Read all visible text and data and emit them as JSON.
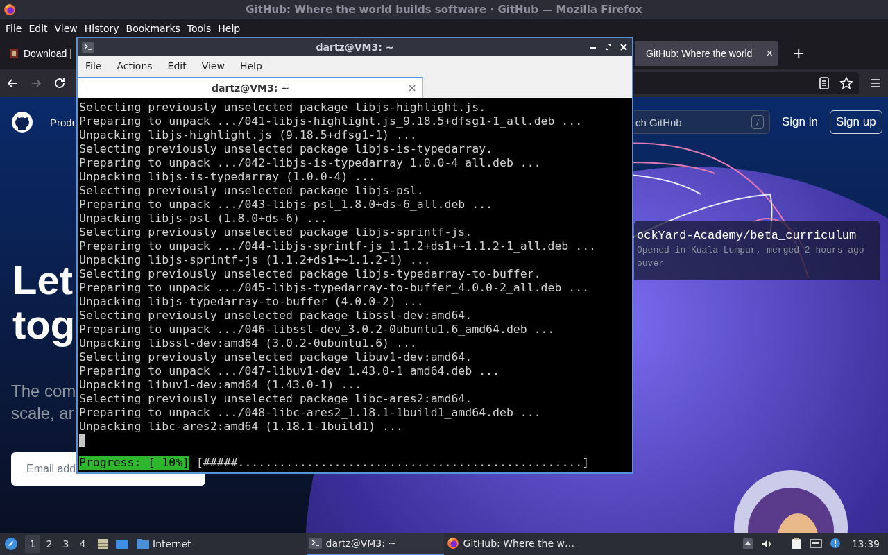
{
  "firefox": {
    "title": "GitHub: Where the world builds software · GitHub — Mozilla Firefox",
    "menu": [
      "File",
      "Edit",
      "View",
      "History",
      "Bookmarks",
      "Tools",
      "Help"
    ],
    "tabs": [
      {
        "label": "Download |",
        "selected": false
      },
      {
        "label": "GitHub: Where the world",
        "selected": true,
        "close": "×"
      }
    ],
    "new_tab": "+",
    "nav_buttons": [
      {
        "kind": "back",
        "disabled": false
      },
      {
        "kind": "forward",
        "disabled": true
      },
      {
        "kind": "reload",
        "disabled": false
      }
    ]
  },
  "page": {
    "nav_item": "Produ",
    "search_placeholder": "ch GitHub",
    "search_key": "/",
    "sign_in": "Sign in",
    "sign_up": "Sign up",
    "headline": [
      "Let",
      "tog"
    ],
    "subtitle": [
      "The com",
      "scale, ar"
    ],
    "email_placeholder": "Email add",
    "card": {
      "title": "ockYard-Academy/beta_curriculum",
      "lines": [
        "Opened in Kuala Lumpur, merged 2 hours ago",
        "ouver"
      ]
    }
  },
  "terminal": {
    "title": "dartz@VM3: ~",
    "menu": [
      "File",
      "Actions",
      "Edit",
      "View",
      "Help"
    ],
    "tabs": [
      {
        "label": "dartz@VM3: ~",
        "selected": true,
        "close": "×"
      }
    ],
    "lines": [
      "Selecting previously unselected package libjs-highlight.js.",
      "Preparing to unpack .../041-libjs-highlight.js_9.18.5+dfsg1-1_all.deb ...",
      "Unpacking libjs-highlight.js (9.18.5+dfsg1-1) ...",
      "Selecting previously unselected package libjs-is-typedarray.",
      "Preparing to unpack .../042-libjs-is-typedarray_1.0.0-4_all.deb ...",
      "Unpacking libjs-is-typedarray (1.0.0-4) ...",
      "Selecting previously unselected package libjs-psl.",
      "Preparing to unpack .../043-libjs-psl_1.8.0+ds-6_all.deb ...",
      "Unpacking libjs-psl (1.8.0+ds-6) ...",
      "Selecting previously unselected package libjs-sprintf-js.",
      "Preparing to unpack .../044-libjs-sprintf-js_1.1.2+ds1+~1.1.2-1_all.deb ...",
      "Unpacking libjs-sprintf-js (1.1.2+ds1+~1.1.2-1) ...",
      "Selecting previously unselected package libjs-typedarray-to-buffer.",
      "Preparing to unpack .../045-libjs-typedarray-to-buffer_4.0.0-2_all.deb ...",
      "Unpacking libjs-typedarray-to-buffer (4.0.0-2) ...",
      "Selecting previously unselected package libssl-dev:amd64.",
      "Preparing to unpack .../046-libssl-dev_3.0.2-0ubuntu1.6_amd64.deb ...",
      "Unpacking libssl-dev:amd64 (3.0.2-0ubuntu1.6) ...",
      "Selecting previously unselected package libuv1-dev:amd64.",
      "Preparing to unpack .../047-libuv1-dev_1.43.0-1_amd64.deb ...",
      "Unpacking libuv1-dev:amd64 (1.43.0-1) ...",
      "Selecting previously unselected package libc-ares2:amd64.",
      "Preparing to unpack .../048-libc-ares2_1.18.1-1build1_amd64.deb ...",
      "Unpacking libc-ares2:amd64 (1.18.1-1build1) ..."
    ],
    "progress": {
      "label": "Progress: [ 10%]",
      "bar": "[#####..................................................]"
    }
  },
  "taskbar": {
    "workspaces": [
      {
        "label": "1",
        "selected": true
      },
      {
        "label": "2",
        "selected": false
      },
      {
        "label": "3",
        "selected": false
      },
      {
        "label": "4",
        "selected": false
      }
    ],
    "folder": "Internet",
    "tasks": [
      {
        "kind": "terminal",
        "label": "dartz@VM3: ~",
        "selected": true
      },
      {
        "kind": "browser",
        "label": "GitHub: Where the w…",
        "selected": false
      }
    ],
    "clock": "13:39"
  }
}
